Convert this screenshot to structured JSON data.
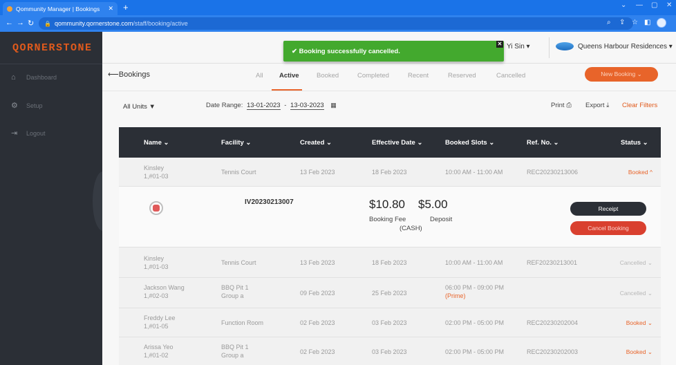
{
  "browser": {
    "tab_title": "Qommunity Manager | Bookings",
    "tab_close": "✕",
    "new_tab": "+",
    "url_host": "qommunity.qornerstone.com",
    "url_path": "/staff/booking/active"
  },
  "sidebar": {
    "logo": "QORNERSTONE",
    "items": [
      {
        "label": "Dashboard",
        "icon": "home-icon"
      },
      {
        "label": "Setup",
        "icon": "gear-icon"
      },
      {
        "label": "Logout",
        "icon": "logout-icon"
      }
    ]
  },
  "topbar": {
    "user": "Yi Sin ▾",
    "estate": "Queens Harbour Residences ▾"
  },
  "toast": {
    "message": "✔ Booking successfully cancelled.",
    "close": "✕"
  },
  "subnav": {
    "back_label": "⟵Bookings",
    "tabs": [
      "All",
      "Active",
      "Booked",
      "Completed",
      "Recent",
      "Reserved",
      "Cancelled"
    ],
    "active_tab": "Active",
    "new_booking": "New Booking ⌄"
  },
  "filters": {
    "units": "All Units  ▼",
    "date_range_label": "Date Range:",
    "date_from": "13-01-2023",
    "date_sep": "-",
    "date_to": "13-03-2023",
    "print": "Print",
    "export": "Export",
    "clear": "Clear Filters"
  },
  "table": {
    "columns": [
      "Name ⌄",
      "Facility ⌄",
      "Created ⌄",
      "Effective Date ⌄",
      "Booked Slots ⌄",
      "Ref. No. ⌄",
      "Status ⌄"
    ],
    "rows": [
      {
        "name": "Kinsley",
        "unit": "1,#01-03",
        "facility": "Tennis Court",
        "facility_sub": "",
        "created": "13 Feb 2023",
        "effective": "18 Feb 2023",
        "slots": "10:00 AM - 11:00 AM",
        "slot_note": "",
        "ref": "REC20230213006",
        "status": "Booked ^",
        "status_type": "booked"
      },
      {
        "name": "Kinsley",
        "unit": "1,#01-03",
        "facility": "Tennis Court",
        "facility_sub": "",
        "created": "13 Feb 2023",
        "effective": "18 Feb 2023",
        "slots": "10:00 AM - 11:00 AM",
        "slot_note": "",
        "ref": "REF20230213001",
        "status": "Cancelled ⌄",
        "status_type": "cancelled"
      },
      {
        "name": "Jackson Wang",
        "unit": "1,#02-03",
        "facility": "BBQ Pit 1",
        "facility_sub": "Group a",
        "created": "09 Feb 2023",
        "effective": "25 Feb 2023",
        "slots": "06:00 PM - 09:00 PM",
        "slot_note": "(Prime)",
        "ref": "",
        "status": "Cancelled ⌄",
        "status_type": "cancelled"
      },
      {
        "name": "Freddy Lee",
        "unit": "1,#01-05",
        "facility": "Function Room",
        "facility_sub": "",
        "created": "02 Feb 2023",
        "effective": "03 Feb 2023",
        "slots": "02:00 PM - 05:00 PM",
        "slot_note": "",
        "ref": "REC20230202004",
        "status": "Booked ⌄",
        "status_type": "booked"
      },
      {
        "name": "Arissa Yeo",
        "unit": "1,#01-02",
        "facility": "BBQ Pit 1",
        "facility_sub": "Group a",
        "created": "02 Feb 2023",
        "effective": "03 Feb 2023",
        "slots": "02:00 PM - 05:00 PM",
        "slot_note": "",
        "ref": "REC20230202003",
        "status": "Booked ⌄",
        "status_type": "booked"
      }
    ],
    "detail": {
      "ref": "IV20230213007",
      "booking_fee": "$10.80",
      "booking_fee_label": "Booking Fee",
      "payment_method": "(CASH)",
      "deposit": "$5.00",
      "deposit_label": "Deposit",
      "receipt_label": "Receipt",
      "cancel_label": "Cancel Booking"
    }
  },
  "colors": {
    "accent": "#e8642a",
    "sidebar": "#2b2f36",
    "toast": "#43a92e",
    "danger": "#d9402f"
  }
}
